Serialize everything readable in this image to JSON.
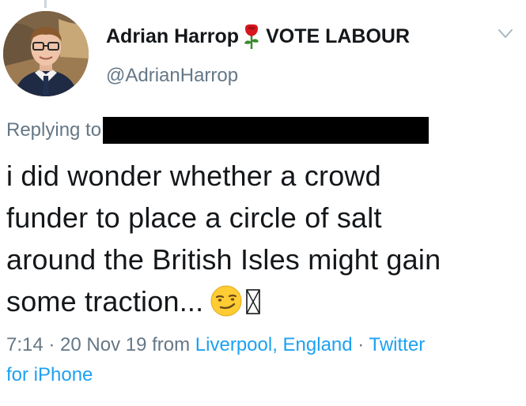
{
  "tweet": {
    "author": {
      "display_name": "Adrian Harrop",
      "name_suffix": "VOTE LABOUR",
      "name_emoji": "rose-icon",
      "handle": "@AdrianHarrop",
      "avatar": "avatar"
    },
    "menu_icon": "chevron-down-icon",
    "replying_label": "Replying to",
    "replying_to": "",
    "text_lines": [
      "i did wonder whether a crowd",
      "funder to place a circle of salt",
      "around the British Isles might gain",
      "some traction..."
    ],
    "text_emojis": [
      "smirk-icon",
      "missing-glyph-icon"
    ],
    "meta": {
      "time": "7:14",
      "separator": " · ",
      "date": "20 Nov 19",
      "from_label": "from",
      "location": "Liverpool, England",
      "source_part1": "Twitter",
      "source_part2": "for iPhone"
    },
    "colors": {
      "text": "#14171a",
      "secondary": "#657786",
      "link": "#1da1f2",
      "redaction": "#000000"
    }
  }
}
